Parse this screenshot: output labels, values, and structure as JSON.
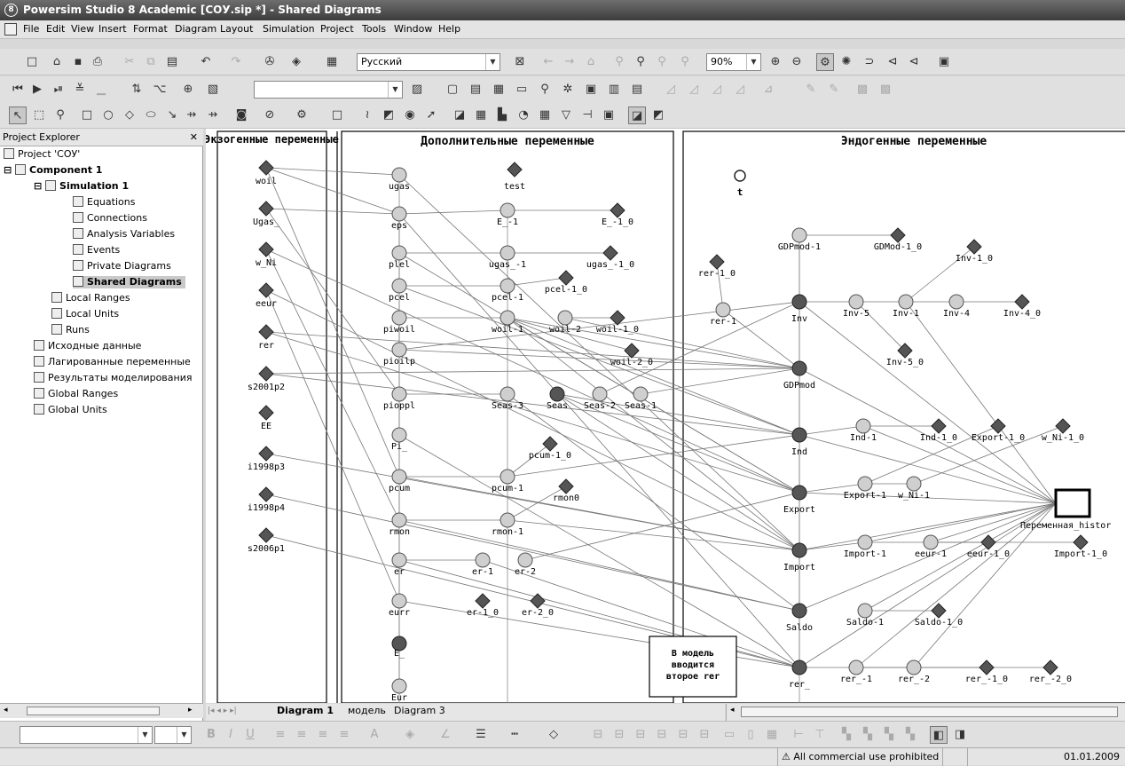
{
  "window": {
    "title": "Powersim Studio 8 Academic [COУ.sip *] - Shared Diagrams"
  },
  "menu": [
    "File",
    "Edit",
    "View",
    "Insert",
    "Format",
    "Diagram",
    "Layout",
    "Simulation",
    "Project",
    "Tools",
    "Window",
    "Help"
  ],
  "toolbar": {
    "language": "Русский",
    "zoom": "90%"
  },
  "explorer": {
    "title": "Project Explorer",
    "project": "Project 'COУ'",
    "component": "Component 1",
    "simulation": "Simulation 1",
    "sim_items": [
      "Equations",
      "Connections",
      "Analysis Variables",
      "Events",
      "Private Diagrams",
      "Shared Diagrams"
    ],
    "component_items": [
      "Local Ranges",
      "Local Units",
      "Runs"
    ],
    "project_items": [
      "Исходные данные",
      "Лагированные переменные",
      "Результаты моделирования",
      "Global Ranges",
      "Global Units"
    ]
  },
  "diagram": {
    "section_exo": "Экзогенные переменные",
    "section_add": "Дополнительные переменные",
    "section_endo": "Эндогенные переменные",
    "note": "В модель вводится второе rer",
    "history_label": "Переменная_histor",
    "exo_vars": [
      "woil",
      "Ugas_",
      "w_Ni",
      "eeur",
      "rer",
      "s2001p2",
      "EE",
      "i1998p3",
      "i1998p4",
      "s2006p1"
    ],
    "add_col1": [
      "ugas",
      "eps",
      "plel",
      "pcel",
      "piwoil",
      "pioilp",
      "pioppl",
      "Pi_",
      "pcum",
      "rmon",
      "er",
      "eurr",
      "E_",
      "Eur"
    ],
    "add_other": [
      "test",
      "E_-1",
      "E_-1_0",
      "ugas_-1",
      "ugas_-1_0",
      "pcel-1",
      "pcel-1_0",
      "woil-1",
      "woil-2",
      "woil-1_0",
      "woil-2_0",
      "Seas-3",
      "Seas",
      "Seas-2",
      "Seas-1",
      "pcum-1_0",
      "pcum-1",
      "rmon0",
      "rmon-1",
      "er-1",
      "er-2",
      "er-1_0",
      "er-2_0"
    ],
    "endo": [
      "t",
      "GDPmod-1",
      "GDMod-1_0",
      "rer-1_0",
      "rer-1",
      "Inv-1_0",
      "Inv",
      "Inv-5",
      "Inv-1",
      "Inv-4",
      "Inv-4_0",
      "Inv-5_0",
      "GDPmod",
      "Ind",
      "Ind-1",
      "Ind-1_0",
      "Export-1_0",
      "w_Ni-1_0",
      "Export",
      "Export-1",
      "w_Ni-1",
      "Import",
      "Import-1",
      "eeur-1",
      "eeur-1_0",
      "Import-1_0",
      "Saldo",
      "Saldo-1",
      "Saldo-1_0",
      "rer_",
      "rer_-1",
      "rer_-2",
      "rer_-1_0",
      "rer_-2_0"
    ]
  },
  "tabs": [
    "Diagram 1",
    "модель",
    "Diagram 3"
  ],
  "status": {
    "notice": "All commercial use prohibited",
    "date": "01.01.2009"
  }
}
